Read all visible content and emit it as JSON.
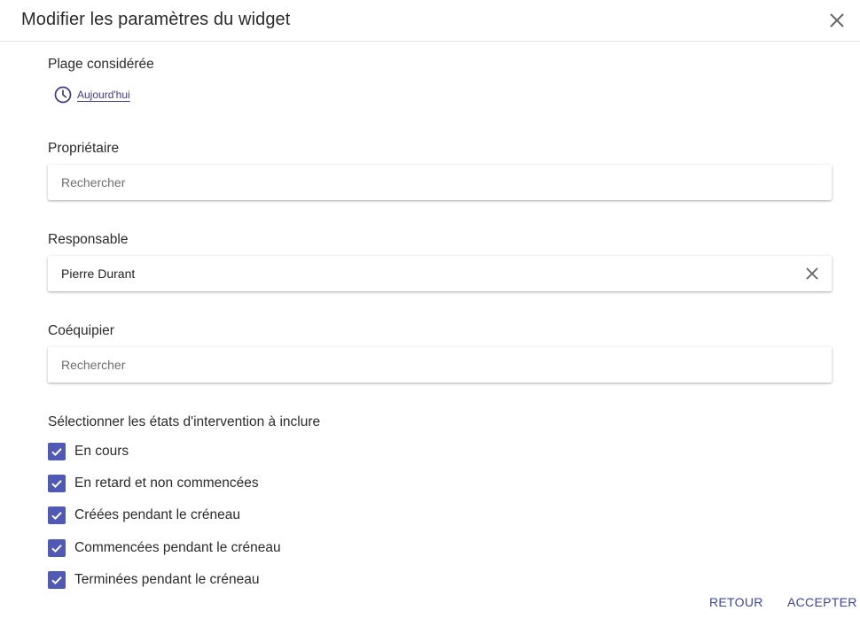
{
  "dialog": {
    "title": "Modifier les paramètres du widget"
  },
  "range": {
    "label": "Plage considérée",
    "value": "Aujourd'hui"
  },
  "owner": {
    "label": "Propriétaire",
    "placeholder": "Rechercher",
    "value": ""
  },
  "responsible": {
    "label": "Responsable",
    "placeholder": "Rechercher",
    "value": "Pierre Durant"
  },
  "teammate": {
    "label": "Coéquipier",
    "placeholder": "Rechercher",
    "value": ""
  },
  "states": {
    "label": "Sélectionner les états d'intervention à inclure",
    "items": [
      {
        "label": "En cours",
        "checked": true
      },
      {
        "label": "En retard et non commencées",
        "checked": true
      },
      {
        "label": "Créées pendant le créneau",
        "checked": true
      },
      {
        "label": "Commencées pendant le créneau",
        "checked": true
      },
      {
        "label": "Terminées pendant le créneau",
        "checked": true
      }
    ]
  },
  "actions": {
    "back": "RETOUR",
    "accept": "ACCEPTER"
  },
  "colors": {
    "accent": "#5059b3",
    "link": "#3f3a86",
    "action": "#3b46a8"
  },
  "icons": {
    "close": "close-icon",
    "clock": "clock-icon",
    "clear": "clear-icon",
    "check": "checkmark-icon"
  }
}
